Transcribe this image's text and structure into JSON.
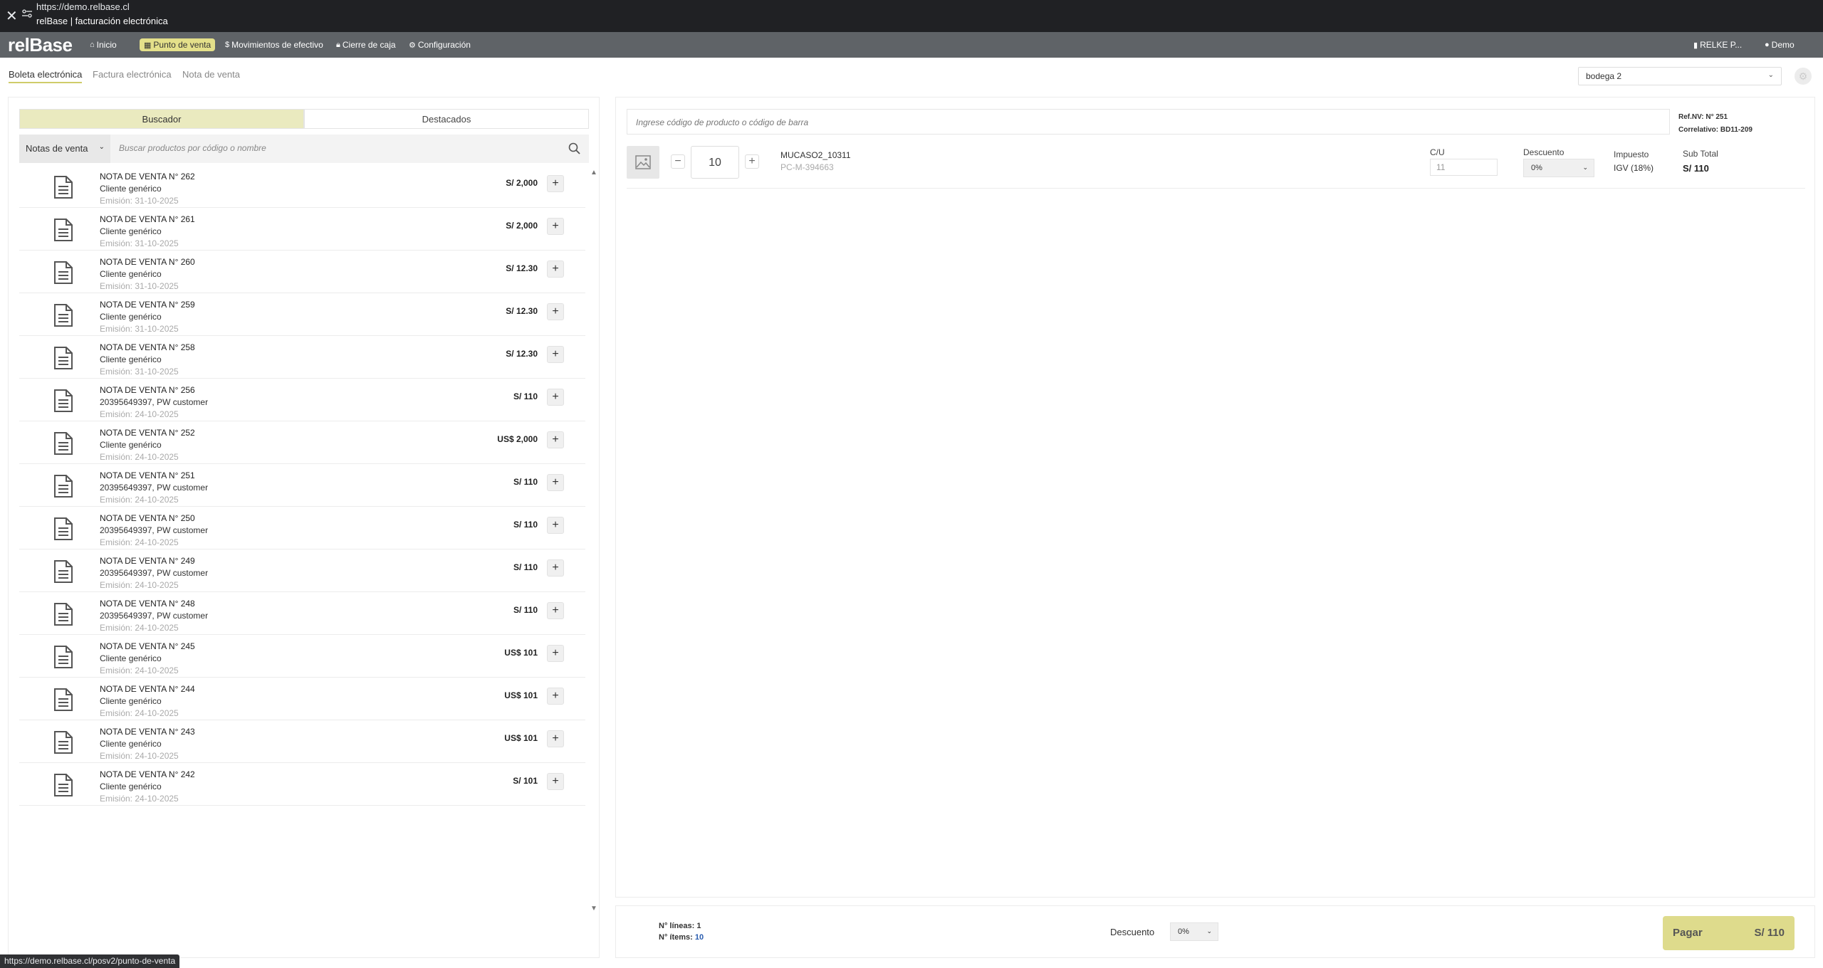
{
  "browser": {
    "url": "https://demo.relbase.cl",
    "page_title": "relBase | facturación electrónica"
  },
  "nav": {
    "logo": "relBase",
    "items": [
      {
        "label": "Inicio",
        "icon": "home-icon"
      },
      {
        "label": "Punto de venta",
        "icon": "calculator-icon",
        "active": true
      },
      {
        "label": "Movimientos de efectivo",
        "icon": "dollar-icon"
      },
      {
        "label": "Cierre de caja",
        "icon": "lock-icon"
      },
      {
        "label": "Configuración",
        "icon": "cogs-icon"
      }
    ],
    "right": [
      {
        "label": "RELKE P...",
        "icon": "building-icon"
      },
      {
        "label": "Demo",
        "icon": "user-icon"
      }
    ]
  },
  "doc_tabs": [
    {
      "label": "Boleta electrónica",
      "active": true
    },
    {
      "label": "Factura electrónica"
    },
    {
      "label": "Nota de venta"
    }
  ],
  "warehouse": "bodega 2",
  "left": {
    "segments": [
      "Buscador",
      "Destacados"
    ],
    "filter": "Notas de venta",
    "search_placeholder": "Buscar productos por código o nombre",
    "items": [
      {
        "title": "NOTA DE VENTA N° 262",
        "client": "Cliente genérico",
        "date": "Emisión: 31-10-2025",
        "amount": "S/ 2,000"
      },
      {
        "title": "NOTA DE VENTA N° 261",
        "client": "Cliente genérico",
        "date": "Emisión: 31-10-2025",
        "amount": "S/ 2,000"
      },
      {
        "title": "NOTA DE VENTA N° 260",
        "client": "Cliente genérico",
        "date": "Emisión: 31-10-2025",
        "amount": "S/ 12.30"
      },
      {
        "title": "NOTA DE VENTA N° 259",
        "client": "Cliente genérico",
        "date": "Emisión: 31-10-2025",
        "amount": "S/ 12.30"
      },
      {
        "title": "NOTA DE VENTA N° 258",
        "client": "Cliente genérico",
        "date": "Emisión: 31-10-2025",
        "amount": "S/ 12.30"
      },
      {
        "title": "NOTA DE VENTA N° 256",
        "client": "20395649397, PW customer",
        "date": "Emisión: 24-10-2025",
        "amount": "S/ 110"
      },
      {
        "title": "NOTA DE VENTA N° 252",
        "client": "Cliente genérico",
        "date": "Emisión: 24-10-2025",
        "amount": "US$ 2,000"
      },
      {
        "title": "NOTA DE VENTA N° 251",
        "client": "20395649397, PW customer",
        "date": "Emisión: 24-10-2025",
        "amount": "S/ 110"
      },
      {
        "title": "NOTA DE VENTA N° 250",
        "client": "20395649397, PW customer",
        "date": "Emisión: 24-10-2025",
        "amount": "S/ 110"
      },
      {
        "title": "NOTA DE VENTA N° 249",
        "client": "20395649397, PW customer",
        "date": "Emisión: 24-10-2025",
        "amount": "S/ 110"
      },
      {
        "title": "NOTA DE VENTA N° 248",
        "client": "20395649397, PW customer",
        "date": "Emisión: 24-10-2025",
        "amount": "S/ 110"
      },
      {
        "title": "NOTA DE VENTA N° 245",
        "client": "Cliente genérico",
        "date": "Emisión: 24-10-2025",
        "amount": "US$ 101"
      },
      {
        "title": "NOTA DE VENTA N° 244",
        "client": "Cliente genérico",
        "date": "Emisión: 24-10-2025",
        "amount": "US$ 101"
      },
      {
        "title": "NOTA DE VENTA N° 243",
        "client": "Cliente genérico",
        "date": "Emisión: 24-10-2025",
        "amount": "US$ 101"
      },
      {
        "title": "NOTA DE VENTA N° 242",
        "client": "Cliente genérico",
        "date": "Emisión: 24-10-2025",
        "amount": "S/ 101"
      }
    ]
  },
  "right": {
    "barcode_placeholder": "Ingrese código de producto o código de barra",
    "ref_nv_label": "Ref.NV:",
    "ref_nv_value": "N° 251",
    "correlativo_label": "Correlativo:",
    "correlativo_value": "BD11-209",
    "columns": {
      "cu": "C/U",
      "discount": "Descuento",
      "tax": "Impuesto",
      "subtotal": "Sub Total"
    },
    "product": {
      "qty": "10",
      "name": "MUCASO2_10311",
      "code": "PC-M-394663",
      "unit_price": "11",
      "discount": "0%",
      "tax": "IGV (18%)",
      "subtotal": "S/ 110"
    }
  },
  "footer": {
    "lines_label": "N° líneas:",
    "lines_value": "1",
    "items_label": "N° ítems:",
    "items_value": "10",
    "discount_label": "Descuento",
    "discount_value": "0%",
    "pay_label": "Pagar",
    "pay_amount": "S/ 110"
  },
  "status_url": "https://demo.relbase.cl/posv2/punto-de-venta",
  "colors": {
    "nav_bg": "#5f6367",
    "accent": "#e4e08a",
    "pay_button": "#dedb8c",
    "segment_active": "#eaeabf"
  }
}
